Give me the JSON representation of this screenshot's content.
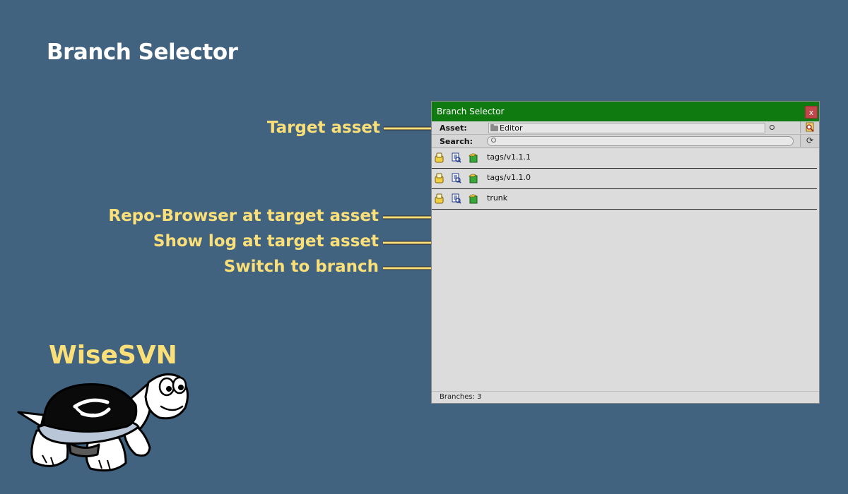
{
  "page": {
    "title": "Branch Selector",
    "brand": "WiseSVN"
  },
  "callouts": {
    "target_asset": "Target asset",
    "repo_browser": "Repo-Browser at target asset",
    "show_log": "Show log at target asset",
    "switch_branch": "Switch to branch"
  },
  "window": {
    "title": "Branch Selector",
    "close_label": "x",
    "asset_label": "Asset:",
    "asset_value": "Editor",
    "search_label": "Search:",
    "search_value": "",
    "refresh_label": "⟳",
    "branches": [
      {
        "name": "tags/v1.1.1"
      },
      {
        "name": "tags/v1.1.0"
      },
      {
        "name": "trunk"
      }
    ],
    "status": "Branches: 3"
  },
  "icons": {
    "row": [
      "repo-browser-icon",
      "show-log-icon",
      "switch-branch-icon"
    ],
    "asset_picker": "object-picker-icon",
    "asset_browse": "browse-asset-icon",
    "refresh": "refresh-icon"
  },
  "colors": {
    "background": "#41637f",
    "callout_text": "#fbe07a",
    "titlebar": "#0e7a10",
    "close_button": "#c0464a",
    "window_body": "#dcdcdc"
  }
}
